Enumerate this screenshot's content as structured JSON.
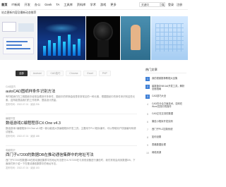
{
  "nav": {
    "items": [
      "首页",
      "IT新闻",
      "开发",
      "办公",
      "Geek",
      "TA",
      "工具库",
      "资料库",
      "学术",
      "游戏",
      "更多"
    ],
    "search_value": "关键词",
    "right_links": [
      "登录",
      "注册"
    ]
  },
  "announcement": "站点更新内容及最新动态推荐",
  "tabs": [
    "全部",
    "Android",
    "CAD技巧",
    "Chrome",
    "Excel",
    "PHP"
  ],
  "articles": [
    {
      "category": "CAD技巧",
      "title": "autoCAD图纸样条件识别方法",
      "desc": "有时候我们在工程图纸中经常会看到许多条件，图纸中的样条曲线是非常常见的一种元素，根据图纸中的条件来识别这些元素，这样能提高我们的工作效率，提高设计质量。",
      "meta": "发布时间：2022-07-01 · 阅读 206"
    },
    {
      "category": "编程开发",
      "title": "数组游戏C编程程序CX:One v4.3",
      "desc": "数组游戏C编程程序CX:One v4.3是一款功能强大的编程程序开发工具，主要用于PLC程序编写，可以帮助用户快速编写和调试程序。",
      "meta": "发布时间：2022-07-01 · 阅读 188"
    },
    {
      "category": "电脑知识",
      "title": "西门子s7200的数据DB在推动通信集群中的地址写法",
      "desc": "西门子S7200的数据DB在推动通信集群中的地址写法是什么?S7200在与其他设备进行通信时，我们常常会用到数据DB，下面我们来介绍一下在推动通信集群中的地址写法。",
      "meta": "发布时间：2022-07-01 · 阅读 153"
    }
  ],
  "sidebar": {
    "title": "热门文章",
    "items": [
      {
        "num": "1",
        "text": "我的视频推荐教程大全集"
      },
      {
        "num": "2",
        "text": "最新版DNW-AA开发工具，解析全面指南"
      },
      {
        "num": "3",
        "text": "CAD技巧大全"
      },
      {
        "num": "4",
        "text": "CAD在分合方面技术，如何在Word文档中的操作"
      },
      {
        "num": "5",
        "text": "CAD正在交流的数据"
      },
      {
        "num": "6",
        "text": "微信小程序开发实例"
      },
      {
        "num": "7",
        "text": "西门子PLC控制系统"
      },
      {
        "num": "8",
        "text": "如何设置"
      },
      {
        "num": "9",
        "text": "表格数据处理"
      },
      {
        "num": "10",
        "text": "网络资源"
      }
    ]
  },
  "colors": {
    "accent": "#3e7fd6",
    "tab_active": "#333333"
  }
}
